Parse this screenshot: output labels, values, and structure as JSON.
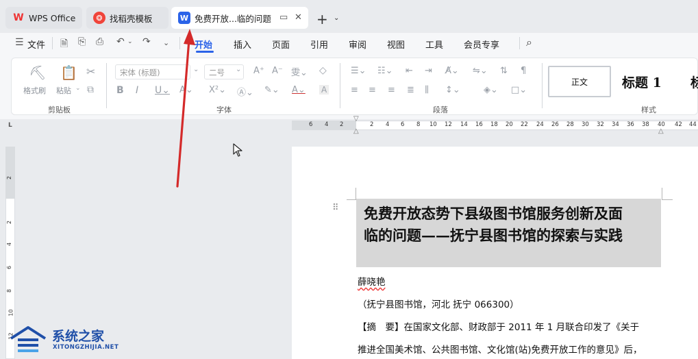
{
  "tabs": [
    {
      "label": "WPS Office",
      "icon": "wps-logo-icon"
    },
    {
      "label": "找稻壳模板",
      "icon": "docer-logo-icon"
    },
    {
      "label": "免费开放...临的问题",
      "icon": "word-doc-icon",
      "logo_letter": "W",
      "active": true
    }
  ],
  "menu": {
    "file": "文件",
    "items": [
      "开始",
      "插入",
      "页面",
      "引用",
      "审阅",
      "视图",
      "工具",
      "会员专享"
    ],
    "active": "开始"
  },
  "ribbon": {
    "clipboard": {
      "format_painter": "格式刷",
      "paste": "粘贴",
      "group": "剪贴板"
    },
    "font": {
      "name": "宋体 (标题)",
      "size": "二号",
      "group": "字体"
    },
    "paragraph": {
      "group": "段落"
    },
    "styles": {
      "normal": "正文",
      "heading1": "标题 1",
      "heading2_partial": "标",
      "group": "样式"
    }
  },
  "ruler": {
    "ticks": [
      "6",
      "4",
      "2",
      "2",
      "4",
      "6",
      "8",
      "10",
      "12",
      "14",
      "16",
      "18",
      "20",
      "22",
      "24",
      "26",
      "28",
      "30",
      "32",
      "34",
      "36",
      "38",
      "40",
      "42",
      "44"
    ],
    "vticks": [
      "2",
      "2",
      "4",
      "6",
      "8",
      "10",
      "12"
    ]
  },
  "document": {
    "title_line1": "免费开放态势下县级图书馆服务创新及面",
    "title_line2": "临的问题——抚宁县图书馆的探索与实践",
    "author": "薛晓艳",
    "affiliation": "（抚宁县图书馆，河北  抚宁  066300）",
    "abstract_line1": "【摘　要】在国家文化部、财政部于 2011 年 1 月联合印发了《关于",
    "abstract_line2": "推进全国美术馆、公共图书馆、文化馆(站)免费开放工作的意见》后，"
  },
  "watermark": {
    "name": "系统之家",
    "url": "XITONGZHIJIA.NET"
  },
  "colors": {
    "accent": "#2b63e8",
    "arrow": "#d42a2a",
    "title_highlight": "#d7d7d7"
  }
}
